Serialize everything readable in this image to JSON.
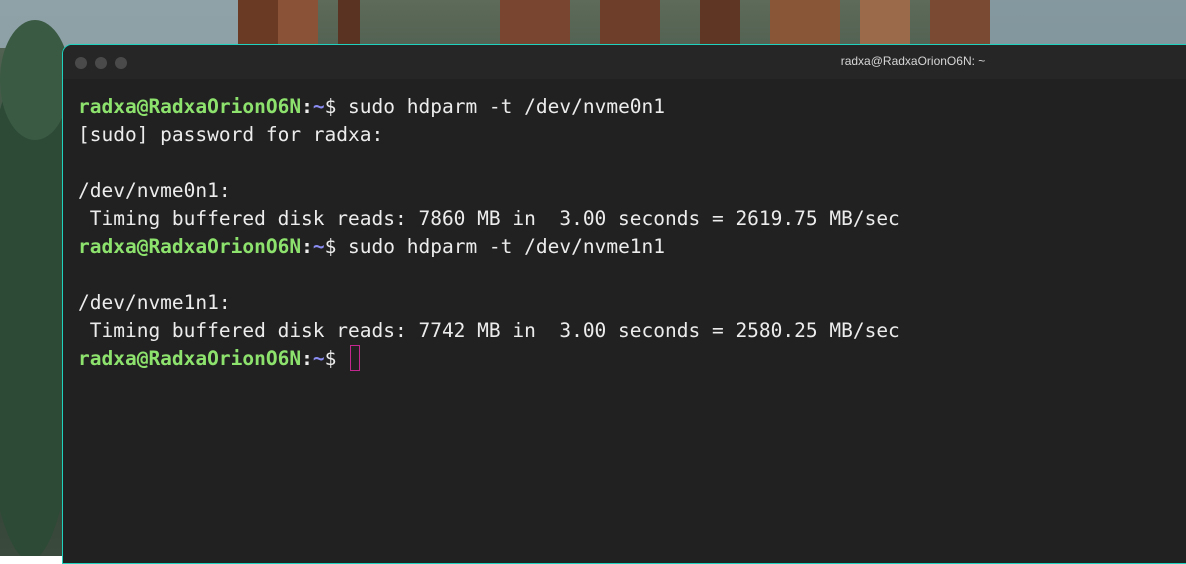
{
  "window": {
    "title": "radxa@RadxaOrionO6N: ~",
    "border_color": "#1fd2c0",
    "background_color": "#212121"
  },
  "prompt": {
    "user_host": "radxa@RadxaOrionO6N",
    "separator": ":",
    "path": "~",
    "symbol": "$"
  },
  "terminal": {
    "lines": [
      {
        "type": "prompt",
        "command": "sudo hdparm -t /dev/nvme0n1"
      },
      {
        "type": "output",
        "text": "[sudo] password for radxa:"
      },
      {
        "type": "output",
        "text": ""
      },
      {
        "type": "output",
        "text": "/dev/nvme0n1:"
      },
      {
        "type": "output",
        "text": " Timing buffered disk reads: 7860 MB in  3.00 seconds = 2619.75 MB/sec"
      },
      {
        "type": "prompt",
        "command": "sudo hdparm -t /dev/nvme1n1"
      },
      {
        "type": "output",
        "text": ""
      },
      {
        "type": "output",
        "text": "/dev/nvme1n1:"
      },
      {
        "type": "output",
        "text": " Timing buffered disk reads: 7742 MB in  3.00 seconds = 2580.25 MB/sec"
      },
      {
        "type": "prompt",
        "command": ""
      }
    ]
  },
  "colors": {
    "user_host": "#8de26d",
    "path": "#8a8cf2",
    "text": "#ececec",
    "cursor": "#c2278f"
  }
}
